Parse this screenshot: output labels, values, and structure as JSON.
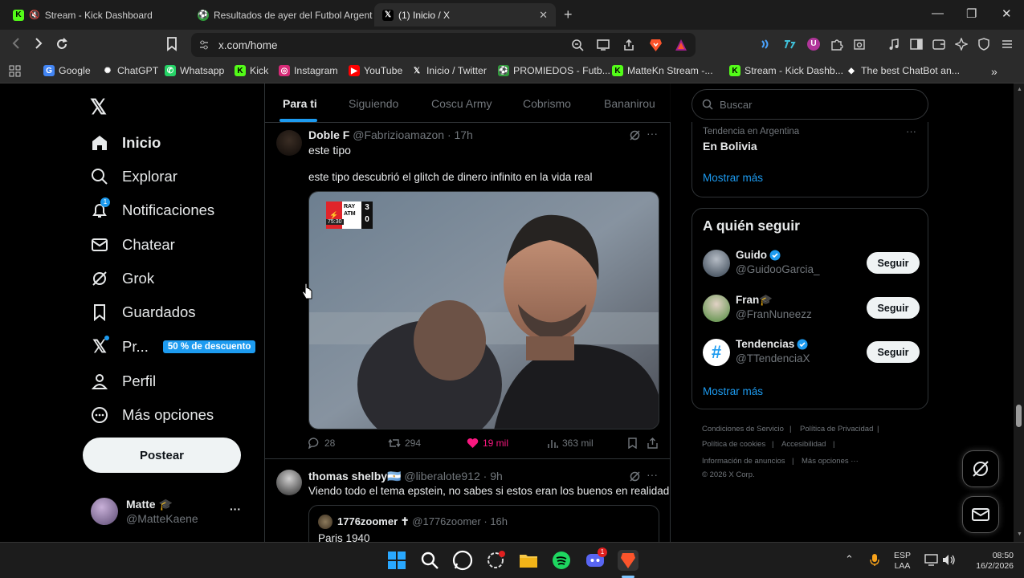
{
  "browser": {
    "tabs": [
      {
        "title": "Stream - Kick Dashboard",
        "fav_color": "#53fc18",
        "fav_glyph": "K"
      },
      {
        "title": "Resultados de ayer del Futbol Argent",
        "fav_color": "#2f9b3a",
        "fav_glyph": "⚽"
      },
      {
        "title": "(1) Inicio / X",
        "fav_color": "#000000",
        "fav_glyph": "𝕏",
        "close": "✕"
      }
    ],
    "new_tab": "+",
    "window": {
      "minimize": "—",
      "restore": "❐",
      "close": "✕"
    },
    "url": "x.com/home",
    "bookmarks": [
      {
        "label": "Google",
        "color": "#4285f4",
        "glyph": "G"
      },
      {
        "label": "ChatGPT",
        "color": "#ffffff",
        "glyph": "✺"
      },
      {
        "label": "Whatsapp",
        "color": "#25d366",
        "glyph": "✆"
      },
      {
        "label": "Kick",
        "color": "#53fc18",
        "glyph": "K"
      },
      {
        "label": "Instagram",
        "color": "#d62976",
        "glyph": "◎"
      },
      {
        "label": "YouTube",
        "color": "#ff0000",
        "glyph": "▶"
      },
      {
        "label": "Inicio / Twitter",
        "color": "#000000",
        "glyph": "𝕏"
      },
      {
        "label": "PROMIEDOS - Futb...",
        "color": "#2f9b3a",
        "glyph": "⚽"
      },
      {
        "label": "MatteKn Stream -...",
        "color": "#53fc18",
        "glyph": "K"
      },
      {
        "label": "Stream - Kick Dashb...",
        "color": "#53fc18",
        "glyph": "K"
      },
      {
        "label": "The best ChatBot an...",
        "color": "#ffffff",
        "glyph": "◆"
      }
    ],
    "bookmarks_more": "»"
  },
  "sidebar": {
    "logo": "𝕏",
    "items": [
      {
        "label": "Inicio",
        "icon": "home-icon",
        "bold": true
      },
      {
        "label": "Explorar",
        "icon": "search-icon"
      },
      {
        "label": "Notificaciones",
        "icon": "bell-icon",
        "badge": "1"
      },
      {
        "label": "Chatear",
        "icon": "mail-icon"
      },
      {
        "label": "Grok",
        "icon": "grok-icon"
      },
      {
        "label": "Guardados",
        "icon": "bookmark-icon"
      },
      {
        "label": "Pr...",
        "icon": "x-premium-icon",
        "promo": "50 % de descuento"
      },
      {
        "label": "Perfil",
        "icon": "person-icon"
      },
      {
        "label": "Más opciones",
        "icon": "more-circle-icon"
      }
    ],
    "post_button": "Postear",
    "account": {
      "name": "Matte 🎓",
      "handle": "@MatteKaene",
      "more": "···"
    }
  },
  "feed": {
    "tabs": [
      "Para ti",
      "Siguiendo",
      "Coscu Army",
      "Cobrismo",
      "Bananirou"
    ],
    "active_tab": 0,
    "posts": [
      {
        "name": "Doble F",
        "handle": "@Fabrizioamazon",
        "time": "· 17h",
        "line1": "este tipo",
        "line2": "este tipo descubrió el glitch de dinero infinito en la vida real",
        "scoreboard": {
          "home": "RAY",
          "away": "ATM",
          "home_score": "3",
          "away_score": "0",
          "clock": "75:30"
        },
        "replies": "28",
        "reposts": "294",
        "likes": "19 mil",
        "views": "363 mil",
        "liked": true
      },
      {
        "name": "thomas shelby🇦🇷",
        "handle": "@liberalote912",
        "time": "· 9h",
        "text": "Viendo todo el tema epstein, no sabes si estos eran los buenos en realidad",
        "quote": {
          "name": "1776zoomer ✝",
          "handle": "@1776zoomer",
          "time": "· 16h",
          "text": "Paris 1940"
        }
      }
    ],
    "more": "···"
  },
  "right": {
    "search_placeholder": "Buscar",
    "trend": {
      "context": "Tendencia en Argentina",
      "title": "En Bolivia",
      "more": "···"
    },
    "show_more": "Mostrar más",
    "who_title": "A quién seguir",
    "who": [
      {
        "name": "Guido",
        "handle": "@GuidooGarcia_",
        "verified": true,
        "avatar_color": "#5a6b7c"
      },
      {
        "name": "Fran🎓",
        "handle": "@FranNuneezz",
        "verified": false,
        "avatar_color": "#4f8a3c"
      },
      {
        "name": "Tendencias",
        "handle": "@TTendenciaX",
        "verified": true,
        "avatar_color": "#ffffff"
      }
    ],
    "follow_label": "Seguir",
    "footer": [
      "Condiciones de Servicio",
      "|",
      "Política de Privacidad",
      "|",
      "Política de cookies",
      "|",
      "Accesibilidad",
      "|",
      "Información de anuncios",
      "|",
      "Más opciones ···",
      "© 2026 X Corp."
    ]
  },
  "taskbar": {
    "lang1": "ESP",
    "lang2": "LAA",
    "time": "08:50",
    "date": "16/2/2026",
    "chevron": "⌃",
    "discord_badge": "1"
  },
  "colors": {
    "accent": "#1d9bf0",
    "like": "#f91880",
    "kick": "#53fc18"
  }
}
